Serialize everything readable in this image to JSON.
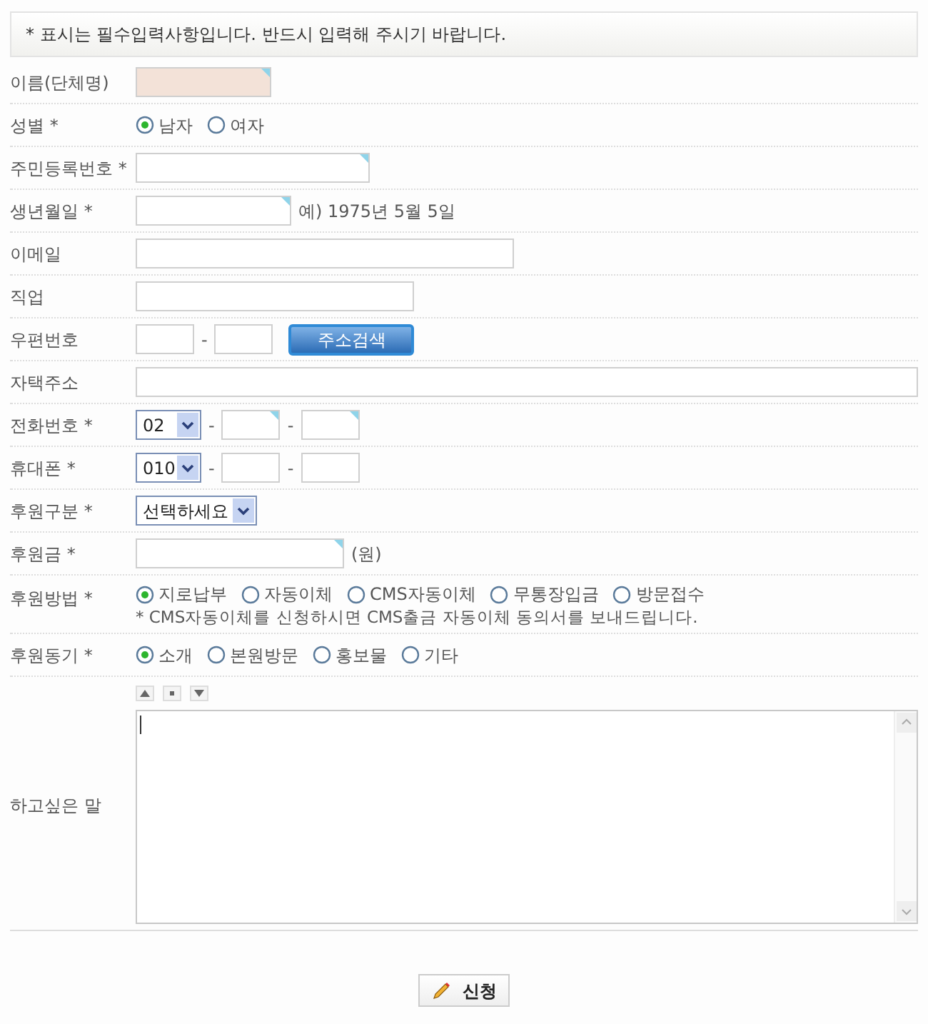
{
  "notice": "* 표시는 필수입력사항입니다. 반드시 입력해 주시기 바랍니다.",
  "rows": [
    {
      "label": "이름(단체명)",
      "kind": "inputs",
      "items": [
        {
          "kind": "field_name",
          "marked": true,
          "shaded": true
        }
      ]
    },
    {
      "label": "성별 *",
      "kind": "inputs",
      "items": [
        {
          "kind": "radio",
          "label": "남자",
          "selected": true
        },
        {
          "kind": "radio",
          "label": "여자",
          "selected": false
        }
      ]
    },
    {
      "label": "주민등록번호 *",
      "kind": "inputs",
      "items": [
        {
          "kind": "field_idnumber",
          "marked": true,
          "shaded": false
        }
      ]
    },
    {
      "label": "생년월일 *",
      "kind": "inputs",
      "items": [
        {
          "kind": "field_date",
          "marked": true,
          "shaded": false
        },
        {
          "kind": "text",
          "text": "예) 1975년 5월 5일"
        }
      ]
    },
    {
      "label": "이메일",
      "kind": "inputs",
      "items": [
        {
          "kind": "field_email",
          "marked": false,
          "shaded": false
        }
      ]
    },
    {
      "label": "직업",
      "kind": "inputs",
      "items": [
        {
          "kind": "field_job",
          "marked": false,
          "shaded": false
        }
      ]
    },
    {
      "label": "우편번호",
      "kind": "inputs",
      "items": [
        {
          "kind": "field_postal",
          "marked": false,
          "shaded": false
        },
        {
          "kind": "text",
          "text": "-"
        },
        {
          "kind": "field_postal",
          "marked": false,
          "shaded": false
        },
        {
          "kind": "button",
          "text": "주소검색"
        }
      ]
    },
    {
      "label": "자택주소",
      "kind": "inputs",
      "items": [
        {
          "kind": "field_address",
          "marked": false,
          "shaded": false
        }
      ]
    },
    {
      "label": "전화번호 *",
      "kind": "inputs",
      "items": [
        {
          "kind": "select_area",
          "value": "02"
        },
        {
          "kind": "text",
          "text": "-"
        },
        {
          "kind": "field_phone",
          "marked": true,
          "shaded": false
        },
        {
          "kind": "text",
          "text": "-"
        },
        {
          "kind": "field_phone",
          "marked": true,
          "shaded": false
        }
      ]
    },
    {
      "label": "휴대폰 *",
      "kind": "inputs",
      "items": [
        {
          "kind": "select_area",
          "value": "010"
        },
        {
          "kind": "text",
          "text": "-"
        },
        {
          "kind": "field_phone",
          "marked": false,
          "shaded": false
        },
        {
          "kind": "text",
          "text": "-"
        },
        {
          "kind": "field_phone",
          "marked": false,
          "shaded": false
        }
      ]
    },
    {
      "label": "후원구분 *",
      "kind": "inputs",
      "items": [
        {
          "kind": "select_wide",
          "value": "선택하세요"
        }
      ]
    },
    {
      "label": "후원금 *",
      "kind": "inputs",
      "items": [
        {
          "kind": "field_amount",
          "marked": true,
          "shaded": false
        },
        {
          "kind": "text",
          "text": "(원)"
        }
      ]
    },
    {
      "label": "후원방법 *",
      "kind": "inputs",
      "items": [
        {
          "kind": "radio",
          "label": "지로납부",
          "selected": true
        },
        {
          "kind": "radio",
          "label": "자동이체",
          "selected": false
        },
        {
          "kind": "radio",
          "label": "CMS자동이체",
          "selected": false
        },
        {
          "kind": "radio",
          "label": "무통장입금",
          "selected": false
        },
        {
          "kind": "radio",
          "label": "방문접수",
          "selected": false
        }
      ],
      "note": "* CMS자동이체를 신청하시면 CMS출금 자동이체 동의서를 보내드립니다."
    },
    {
      "label": "후원동기 *",
      "kind": "inputs",
      "items": [
        {
          "kind": "radio",
          "label": "소개",
          "selected": true
        },
        {
          "kind": "radio",
          "label": "본원방문",
          "selected": false
        },
        {
          "kind": "radio",
          "label": "홍보물",
          "selected": false
        },
        {
          "kind": "radio",
          "label": "기타",
          "selected": false
        }
      ]
    },
    {
      "label": "하고싶은 말",
      "kind": "textarea"
    }
  ],
  "submit": {
    "label": "신청"
  }
}
